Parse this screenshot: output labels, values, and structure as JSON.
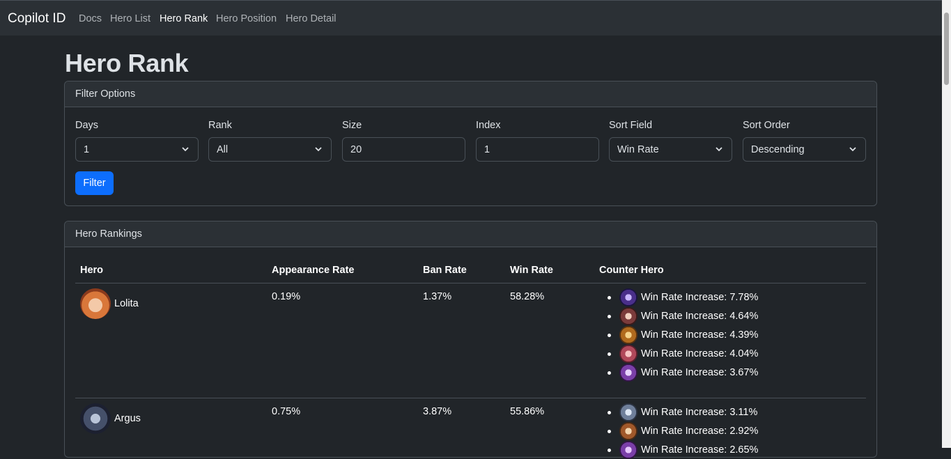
{
  "nav": {
    "brand": "Copilot ID",
    "links": [
      "Docs",
      "Hero List",
      "Hero Rank",
      "Hero Position",
      "Hero Detail"
    ],
    "active": "Hero Rank"
  },
  "page": {
    "title": "Hero Rank"
  },
  "filter": {
    "header": "Filter Options",
    "fields": [
      {
        "label": "Days",
        "value": "1",
        "type": "select"
      },
      {
        "label": "Rank",
        "value": "All",
        "type": "select"
      },
      {
        "label": "Size",
        "value": "20",
        "type": "input"
      },
      {
        "label": "Index",
        "value": "1",
        "type": "input"
      },
      {
        "label": "Sort Field",
        "value": "Win Rate",
        "type": "select"
      },
      {
        "label": "Sort Order",
        "value": "Descending",
        "type": "select"
      }
    ],
    "button": "Filter"
  },
  "rankings": {
    "header": "Hero Rankings",
    "columns": [
      "Hero",
      "Appearance Rate",
      "Ban Rate",
      "Win Rate",
      "Counter Hero"
    ],
    "rows": [
      {
        "hero": "Lolita",
        "appearance": "0.19%",
        "ban": "1.37%",
        "win": "58.28%",
        "counters": [
          "Win Rate Increase: 7.78%",
          "Win Rate Increase: 4.64%",
          "Win Rate Increase: 4.39%",
          "Win Rate Increase: 4.04%",
          "Win Rate Increase: 3.67%"
        ]
      },
      {
        "hero": "Argus",
        "appearance": "0.75%",
        "ban": "3.87%",
        "win": "55.86%",
        "counters": [
          "Win Rate Increase: 3.11%",
          "Win Rate Increase: 2.92%",
          "Win Rate Increase: 2.65%"
        ]
      }
    ]
  },
  "colors": {
    "background": "#212529",
    "navbar": "#2b3035",
    "border": "#495057",
    "primary": "#0d6efd"
  }
}
